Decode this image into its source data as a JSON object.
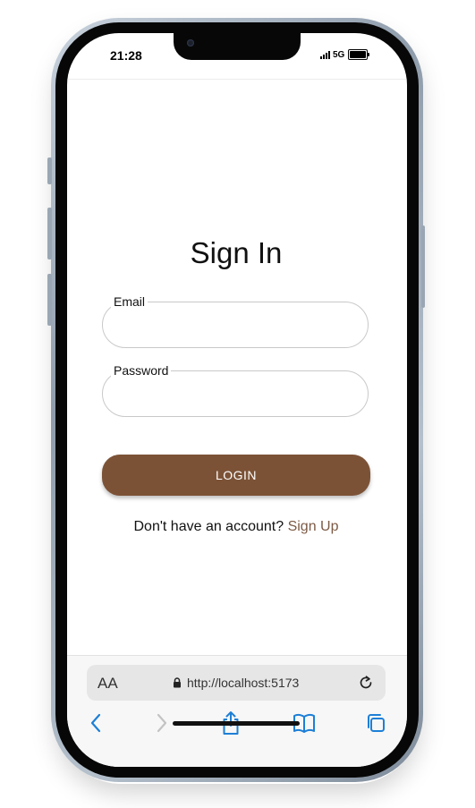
{
  "status_bar": {
    "time": "21:28",
    "network": "5G"
  },
  "page": {
    "title": "Sign In",
    "email_label": "Email",
    "email_value": "",
    "password_label": "Password",
    "password_value": "",
    "login_label": "LOGIN",
    "signup_prompt": "Don't have an account?",
    "signup_link": "Sign Up"
  },
  "browser": {
    "text_size_label": "AA",
    "url": "http://localhost:5173"
  },
  "colors": {
    "login_button": "#7c5236",
    "signup_link": "#7c5a45",
    "toolbar_icon": "#1d7fd6"
  }
}
